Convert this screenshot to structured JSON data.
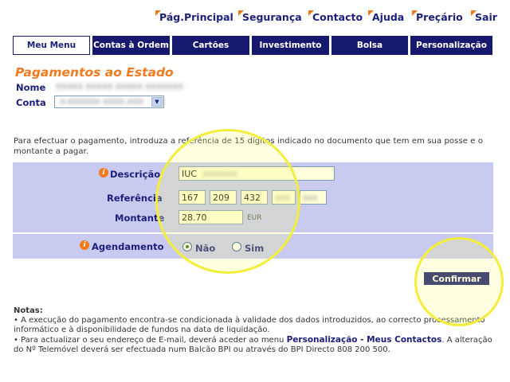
{
  "top_links": [
    "Pág.Principal",
    "Segurança",
    "Contacto",
    "Ajuda",
    "Preçário",
    "Sair"
  ],
  "tabs": [
    "Meu Menu",
    "Contas à Ordem",
    "Cartões",
    "Investimento",
    "Bolsa",
    "Personalização"
  ],
  "active_tab": "Meu Menu",
  "page_title": "Pagamentos ao Estado",
  "name_label": "Nome",
  "name_value": "XXXXX XXXXX XXXXX XXXXXXX",
  "account_label": "Conta",
  "account_value": "X-XXXXXX XXXX.XXX",
  "instructions": "Para efectuar o pagamento, introduza a referência de 15 dígitos indicado no documento que tem em sua posse e o montante a pagar.",
  "form": {
    "descricao_label": "Descrição",
    "descricao_value": "IUC",
    "descricao_hidden": "XXXXXXX",
    "referencia_label": "Referência",
    "referencia_parts": [
      "167",
      "209",
      "432",
      "XXX",
      "XXX"
    ],
    "montante_label": "Montante",
    "montante_value": "28.70",
    "montante_unit": "EUR",
    "agendamento_label": "Agendamento",
    "options": [
      "Não",
      "Sim"
    ],
    "selected_option": "Não"
  },
  "confirm_button": "Confirmar",
  "notes": {
    "title": "Notas:",
    "note1": "• A execução do pagamento encontra-se condicionada à validade dos dados introduzidos, ao correcto processamento informático e à disponibilidade de fundos na data de liquidação.",
    "note2_part1": "• Para actualizar o seu endereço de E-mail, deverá aceder ao menu",
    "note2_link": "Personalização - Meus Contactos",
    "note2_part2": ". A alteração do Nº Telemóvel deverá ser efectuada num Balcão BPI ou através do BPI Directo 808 200 500."
  },
  "colors": {
    "navy": "#17196e",
    "orange": "#f47a1f",
    "panel": "#c8caf0",
    "highlight": "#f2ee3a"
  },
  "icons": [
    "orange-corner-icon",
    "info-icon",
    "dropdown-arrow-icon"
  ]
}
